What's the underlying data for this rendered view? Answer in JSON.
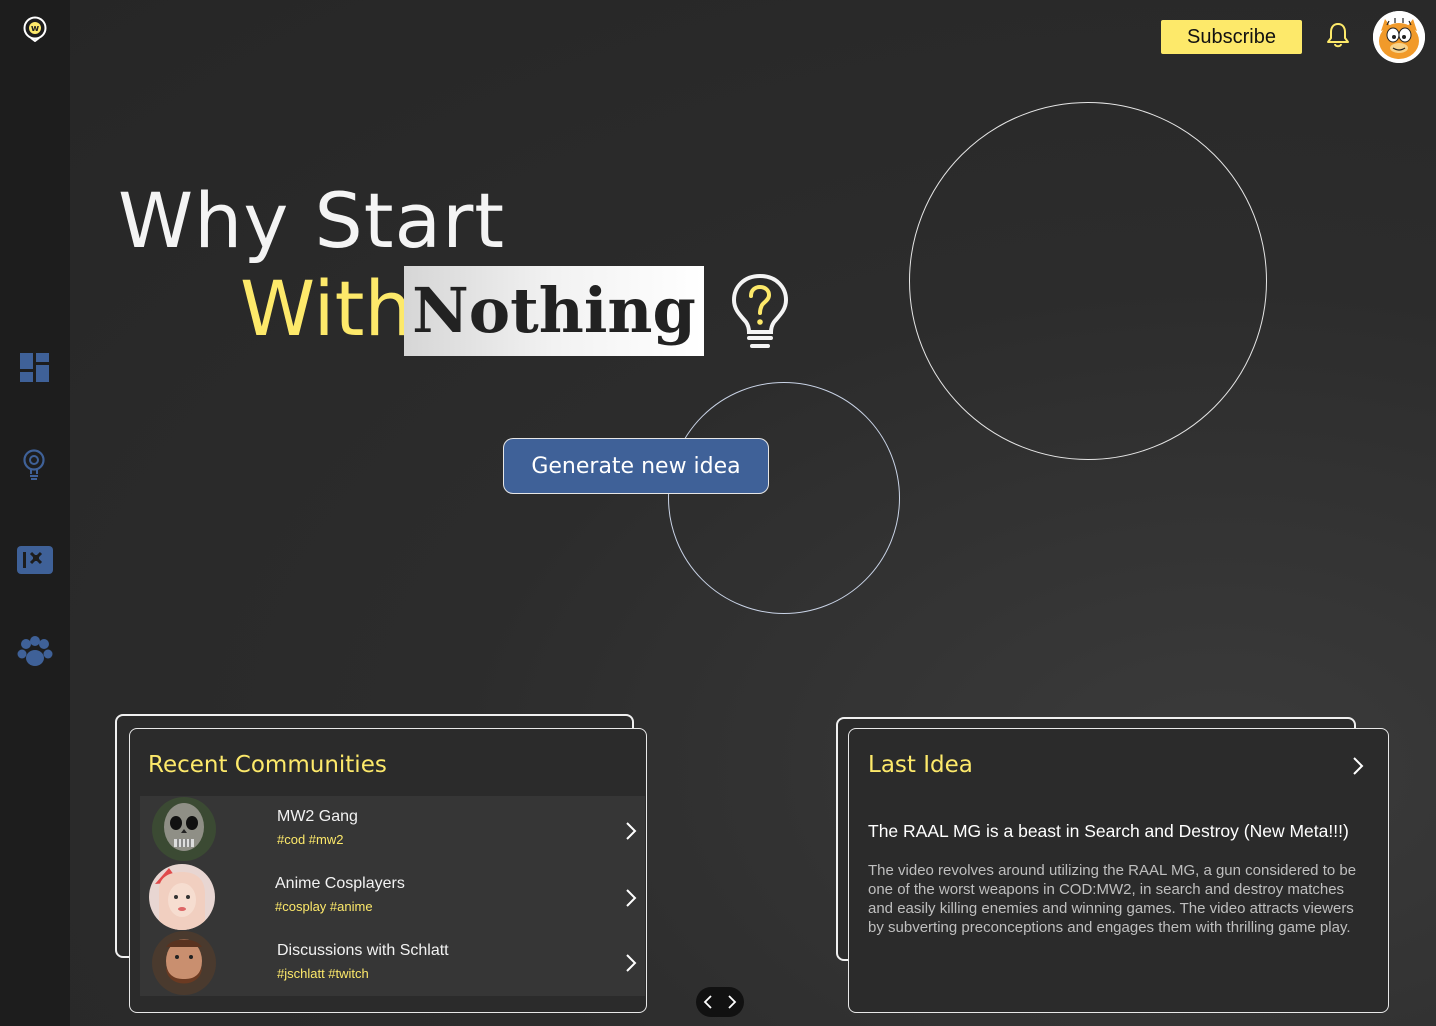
{
  "sidebar": {
    "logo_letter": "w",
    "items": [
      {
        "icon": "dashboard-icon"
      },
      {
        "icon": "idea-bulb-icon"
      },
      {
        "icon": "ticket-icon"
      },
      {
        "icon": "paw-community-icon"
      }
    ]
  },
  "topbar": {
    "subscribe_label": "Subscribe",
    "bell_icon": "bell-icon",
    "avatar_icon": "garfield-avatar"
  },
  "hero": {
    "line1": "Why Start",
    "with": "With",
    "nothing": "Nothing",
    "bulb_icon": "question-bulb-icon",
    "generate_label": "Generate new idea"
  },
  "recent_communities": {
    "title": "Recent Communities",
    "items": [
      {
        "name": "MW2 Gang",
        "tags": "#cod #mw2",
        "avatar": "skull-mask-avatar"
      },
      {
        "name": "Anime Cosplayers",
        "tags": "#cosplay #anime",
        "avatar": "cosplayer-avatar"
      },
      {
        "name": "Discussions with Schlatt",
        "tags": "#jschlatt #twitch",
        "avatar": "bearded-man-avatar"
      }
    ]
  },
  "last_idea": {
    "title": "Last Idea",
    "heading": "The RAAL MG is a beast in Search and Destroy (New Meta!!!)",
    "body": "The video revolves around utilizing the RAAL MG, a gun considered to be one of the worst weapons in COD:MW2, in search and destroy matches and easily killing enemies and winning games. The video attracts viewers by subverting preconceptions and engages them with thrilling game play."
  },
  "colors": {
    "accent_yellow": "#fde96a",
    "accent_blue": "#3f6198",
    "sidebar_bg": "#1d1d1d"
  }
}
